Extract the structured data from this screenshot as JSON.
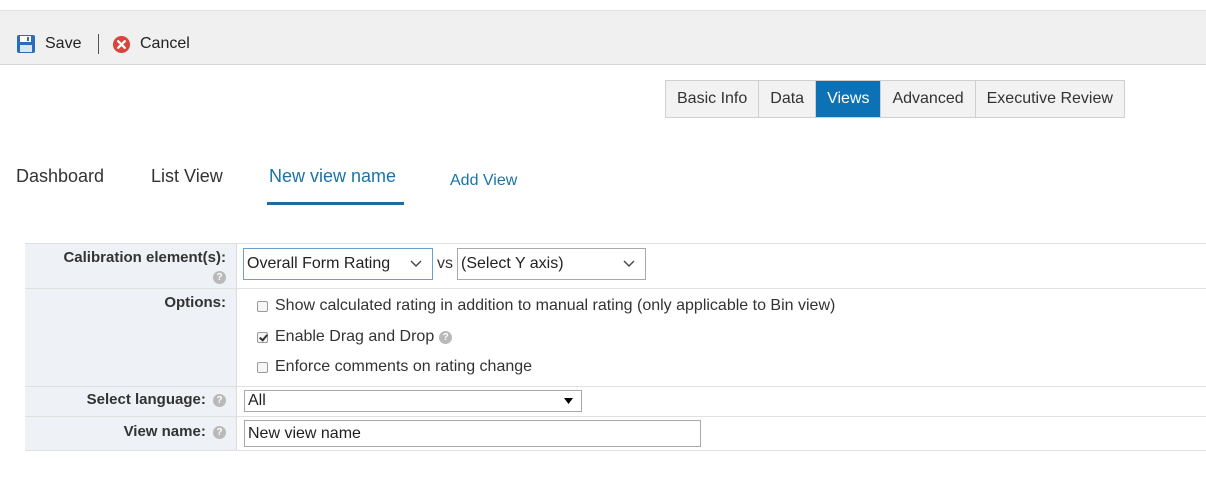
{
  "toolbar": {
    "save_label": "Save",
    "cancel_label": "Cancel"
  },
  "tabs": [
    {
      "label": "Basic Info",
      "active": false
    },
    {
      "label": "Data",
      "active": false
    },
    {
      "label": "Views",
      "active": true
    },
    {
      "label": "Advanced",
      "active": false
    },
    {
      "label": "Executive Review",
      "active": false
    }
  ],
  "view_tabs": {
    "items": [
      {
        "label": "Dashboard"
      },
      {
        "label": "List View"
      },
      {
        "label": "New view name"
      }
    ],
    "active": "New view name",
    "add_label": "Add View"
  },
  "form": {
    "calibration": {
      "label": "Calibration element(s):",
      "x_value": "Overall Form Rating",
      "vs_label": "vs",
      "y_value": "(Select Y axis)"
    },
    "options": {
      "label": "Options:",
      "items": [
        {
          "label": "Show calculated rating in addition to manual rating (only applicable to Bin view)",
          "checked": false
        },
        {
          "label": "Enable Drag and Drop",
          "checked": true
        },
        {
          "label": "Enforce comments on rating change",
          "checked": false
        }
      ]
    },
    "language": {
      "label": "Select language:",
      "value": "All"
    },
    "view_name": {
      "label": "View name:",
      "value": "New view name"
    }
  },
  "colors": {
    "accent": "#0c72b5",
    "link": "#1a73a8",
    "label_bg": "#eef1f5",
    "toolbar_bg": "#f0f0f0"
  },
  "icons": [
    "save-icon",
    "cancel-icon",
    "chevron-down-icon",
    "help-icon"
  ]
}
